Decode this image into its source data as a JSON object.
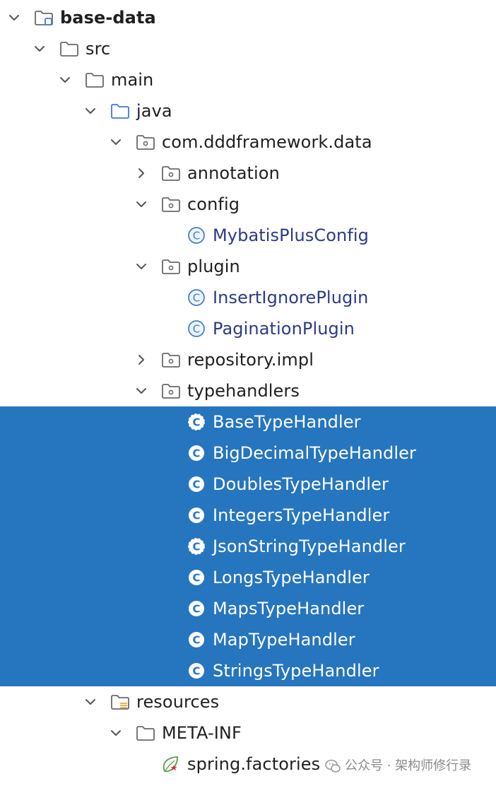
{
  "tree": [
    {
      "label": "base-data",
      "icon": "module-folder-icon",
      "state": "expanded",
      "level": 0,
      "bold": true
    },
    {
      "label": "src",
      "icon": "folder-icon",
      "state": "expanded",
      "level": 1
    },
    {
      "label": "main",
      "icon": "folder-icon",
      "state": "expanded",
      "level": 2
    },
    {
      "label": "java",
      "icon": "source-folder-icon",
      "state": "expanded",
      "level": 3
    },
    {
      "label": "com.dddframework.data",
      "icon": "package-icon",
      "state": "expanded",
      "level": 4
    },
    {
      "label": "annotation",
      "icon": "package-icon",
      "state": "collapsed",
      "level": 5
    },
    {
      "label": "config",
      "icon": "package-icon",
      "state": "expanded",
      "level": 5
    },
    {
      "label": "MybatisPlusConfig",
      "icon": "class-icon",
      "state": "leaf",
      "level": 6,
      "kind": "class"
    },
    {
      "label": "plugin",
      "icon": "package-icon",
      "state": "expanded",
      "level": 5
    },
    {
      "label": "InsertIgnorePlugin",
      "icon": "class-icon",
      "state": "leaf",
      "level": 6,
      "kind": "class"
    },
    {
      "label": "PaginationPlugin",
      "icon": "class-icon",
      "state": "leaf",
      "level": 6,
      "kind": "class"
    },
    {
      "label": "repository.impl",
      "icon": "package-icon",
      "state": "collapsed",
      "level": 5
    },
    {
      "label": "typehandlers",
      "icon": "package-icon",
      "state": "expanded",
      "level": 5
    },
    {
      "label": "BaseTypeHandler",
      "icon": "abstract-class-icon",
      "state": "leaf",
      "level": 6,
      "kind": "class",
      "selected": true
    },
    {
      "label": "BigDecimalTypeHandler",
      "icon": "class-icon",
      "state": "leaf",
      "level": 6,
      "kind": "class",
      "selected": true
    },
    {
      "label": "DoublesTypeHandler",
      "icon": "class-icon",
      "state": "leaf",
      "level": 6,
      "kind": "class",
      "selected": true
    },
    {
      "label": "IntegersTypeHandler",
      "icon": "class-icon",
      "state": "leaf",
      "level": 6,
      "kind": "class",
      "selected": true
    },
    {
      "label": "JsonStringTypeHandler",
      "icon": "abstract-class-icon",
      "state": "leaf",
      "level": 6,
      "kind": "class",
      "selected": true
    },
    {
      "label": "LongsTypeHandler",
      "icon": "class-icon",
      "state": "leaf",
      "level": 6,
      "kind": "class",
      "selected": true
    },
    {
      "label": "MapsTypeHandler",
      "icon": "class-icon",
      "state": "leaf",
      "level": 6,
      "kind": "class",
      "selected": true
    },
    {
      "label": "MapTypeHandler",
      "icon": "class-icon",
      "state": "leaf",
      "level": 6,
      "kind": "class",
      "selected": true
    },
    {
      "label": "StringsTypeHandler",
      "icon": "class-icon",
      "state": "leaf",
      "level": 6,
      "kind": "class",
      "selected": true
    },
    {
      "label": "resources",
      "icon": "resources-folder-icon",
      "state": "expanded",
      "level": 3
    },
    {
      "label": "META-INF",
      "icon": "folder-icon",
      "state": "expanded",
      "level": 4
    },
    {
      "label": "spring.factories",
      "icon": "spring-factories-icon",
      "state": "leaf",
      "level": 5
    }
  ],
  "watermark": {
    "text": "公众号 · 架构师修行录",
    "icon": "wechat-icon"
  },
  "colors": {
    "selection": "#2675bf",
    "class_text": "#2b3b86",
    "class_icon": "#3a7bd5",
    "text": "#1f1f1f"
  }
}
